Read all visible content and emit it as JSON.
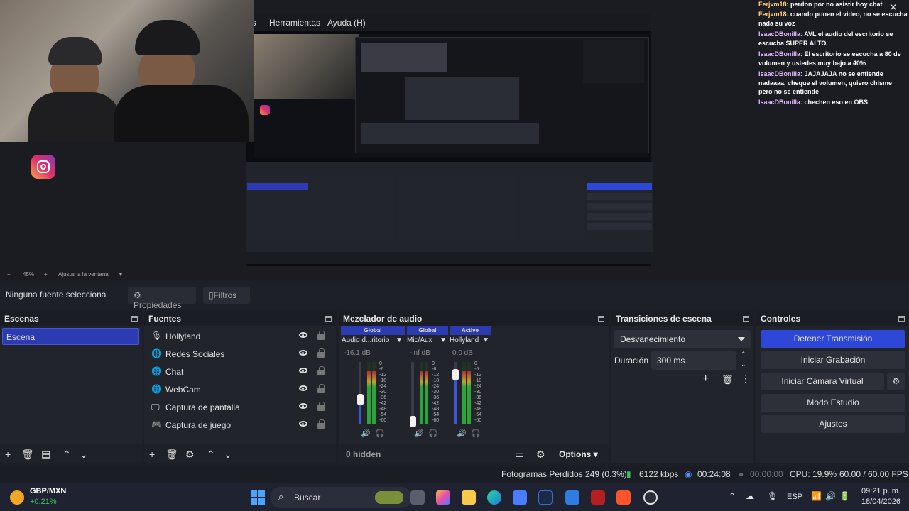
{
  "preview": {
    "menu": [
      "as",
      "Herramientas",
      "Ayuda (H)"
    ],
    "zoom": {
      "minus": "−",
      "level": "45%",
      "plus": "+",
      "fit": "Ajustar a la ventana"
    }
  },
  "chat": {
    "messages": [
      {
        "user": "Ferjvm18:",
        "text": " perdon por no asistir hoy chat"
      },
      {
        "user": "Ferjvm18:",
        "text": " cuando ponen el video, no se escucha nada su voz"
      },
      {
        "user": "IsaacDBonilla:",
        "text": " AVL el audio del escritorio se escucha SUPER ALTO."
      },
      {
        "user": "IsaacDBonilla:",
        "text": " El escritorio se escucha a 80 de volumen y ustedes muy bajo a 40%"
      },
      {
        "user": "IsaacDBonilla:",
        "text": " JAJAJAJA no se entiende nadaaaa, cheque el volumen, quiero chisme pero no se entiende"
      },
      {
        "user": "IsaacDBonilla:",
        "text": " chechen eso en OBS"
      }
    ],
    "close": "✕"
  },
  "source_bar": {
    "no_source": "Ninguna fuente selecciona",
    "properties": "Propiedades",
    "filters": "Filtros"
  },
  "scenes": {
    "title": "Escenas",
    "items": [
      "Escena"
    ]
  },
  "sources": {
    "title": "Fuentes",
    "items": [
      {
        "label": "Hollyland",
        "icon": "microphone-icon"
      },
      {
        "label": "Redes Sociales",
        "icon": "globe-icon"
      },
      {
        "label": "Chat",
        "icon": "globe-icon"
      },
      {
        "label": "WebCam",
        "icon": "globe-icon"
      },
      {
        "label": "Captura de pantalla",
        "icon": "monitor-icon"
      },
      {
        "label": "Captura de juego",
        "icon": "gamepad-icon"
      }
    ]
  },
  "mixer": {
    "title": "Mezclador de audio",
    "channels": [
      {
        "tag": "Global",
        "name": "Audio d...ritorio",
        "db": "-16.1 dB",
        "level": 0.4,
        "meter": 0.85
      },
      {
        "tag": "Global",
        "name": "Mic/Aux",
        "db": "-inf dB",
        "level": 0.05,
        "meter": 0.85
      },
      {
        "tag": "Active",
        "name": "Hollyland",
        "db": "0.0 dB",
        "level": 0.8,
        "meter": 0.85
      }
    ],
    "scale": [
      "0",
      "-6",
      "-12",
      "-18",
      "-24",
      "-30",
      "-36",
      "-42",
      "-48",
      "-54",
      "-60"
    ],
    "hidden": "0 hidden",
    "options": "Options"
  },
  "transitions": {
    "title": "Transiciones de escena",
    "selected": "Desvanecimiento",
    "duration_label": "Duración",
    "duration_value": "300 ms"
  },
  "controls": {
    "title": "Controles",
    "stop_stream": "Detener Transmisión",
    "start_recording": "Iniciar Grabación",
    "virtual_cam": "Iniciar Cámara Virtual",
    "studio_mode": "Modo Estudio",
    "settings": "Ajustes"
  },
  "status": {
    "dropped": "Fotogramas Perdidos 249 (0.3%)",
    "bitrate": "6122 kbps",
    "stream_time": "00:24:08",
    "rec_time": "00:00:00",
    "cpu": "CPU: 19.9%",
    "fps": "60.00 / 60.00 FPS"
  },
  "taskbar": {
    "ticker": "GBP/MXN",
    "ticker_change": "+0.21%",
    "search": "Buscar",
    "lang": "ESP",
    "time": "09:21 p. m.",
    "date": "18/04/2026"
  }
}
